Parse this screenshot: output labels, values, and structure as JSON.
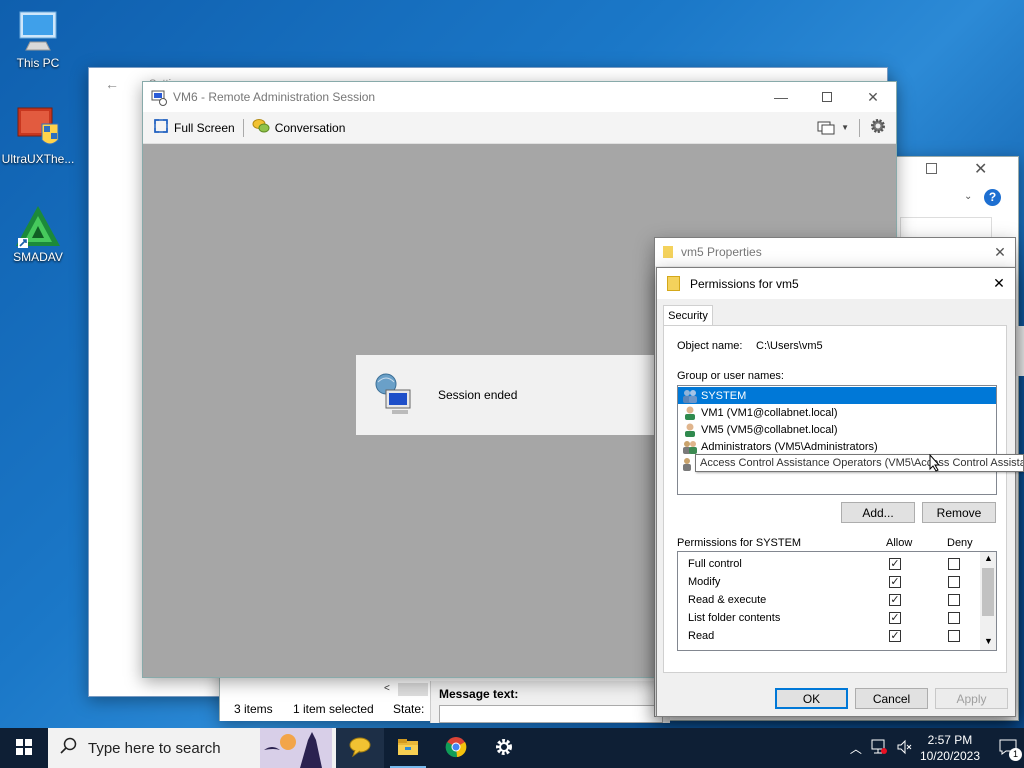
{
  "desktop": {
    "icons": [
      {
        "label": "This PC",
        "icon": "this-pc-icon"
      },
      {
        "label": "UltraUXThe...",
        "icon": "ultraux-icon"
      },
      {
        "label": "SMADAV",
        "icon": "smadav-icon"
      }
    ]
  },
  "back_window": {
    "title": "Settin..."
  },
  "explorer_window": {
    "status_items": "3 items",
    "status_selected": "1 item selected",
    "status_state": "State:",
    "message_label": "Message text:"
  },
  "remote_session": {
    "title": "VM6 - Remote Administration Session",
    "toolbar": {
      "full_screen": "Full Screen",
      "conversation": "Conversation"
    },
    "message": "Session ended"
  },
  "properties": {
    "title": "vm5 Properties"
  },
  "permissions": {
    "title": "Permissions for vm5",
    "tab": "Security",
    "object_label": "Object name:",
    "object_value": "C:\\Users\\vm5",
    "group_label": "Group or user names:",
    "users": [
      {
        "name": "SYSTEM",
        "selected": true
      },
      {
        "name": "VM1 (VM1@collabnet.local)",
        "selected": false
      },
      {
        "name": "VM5 (VM5@collabnet.local)",
        "selected": false
      },
      {
        "name": "Administrators (VM5\\Administrators)",
        "selected": false
      }
    ],
    "tooltip": "Access Control Assistance Operators (VM5\\Access Control Assistance",
    "add_label": "Add...",
    "remove_label": "Remove",
    "perm_header": "Permissions for SYSTEM",
    "allow_header": "Allow",
    "deny_header": "Deny",
    "perms": [
      {
        "name": "Full control",
        "allow": true,
        "deny": false
      },
      {
        "name": "Modify",
        "allow": true,
        "deny": false
      },
      {
        "name": "Read & execute",
        "allow": true,
        "deny": false
      },
      {
        "name": "List folder contents",
        "allow": true,
        "deny": false
      },
      {
        "name": "Read",
        "allow": true,
        "deny": false
      }
    ],
    "ok_label": "OK",
    "cancel_label": "Cancel",
    "apply_label": "Apply"
  },
  "taskbar": {
    "search_placeholder": "Type here to search",
    "time": "2:57 PM",
    "date": "10/20/2023",
    "notification_count": "1"
  },
  "colors": {
    "accent": "#0078d7",
    "desktop": "#1b78c8",
    "taskbar": "#0e1f35"
  }
}
